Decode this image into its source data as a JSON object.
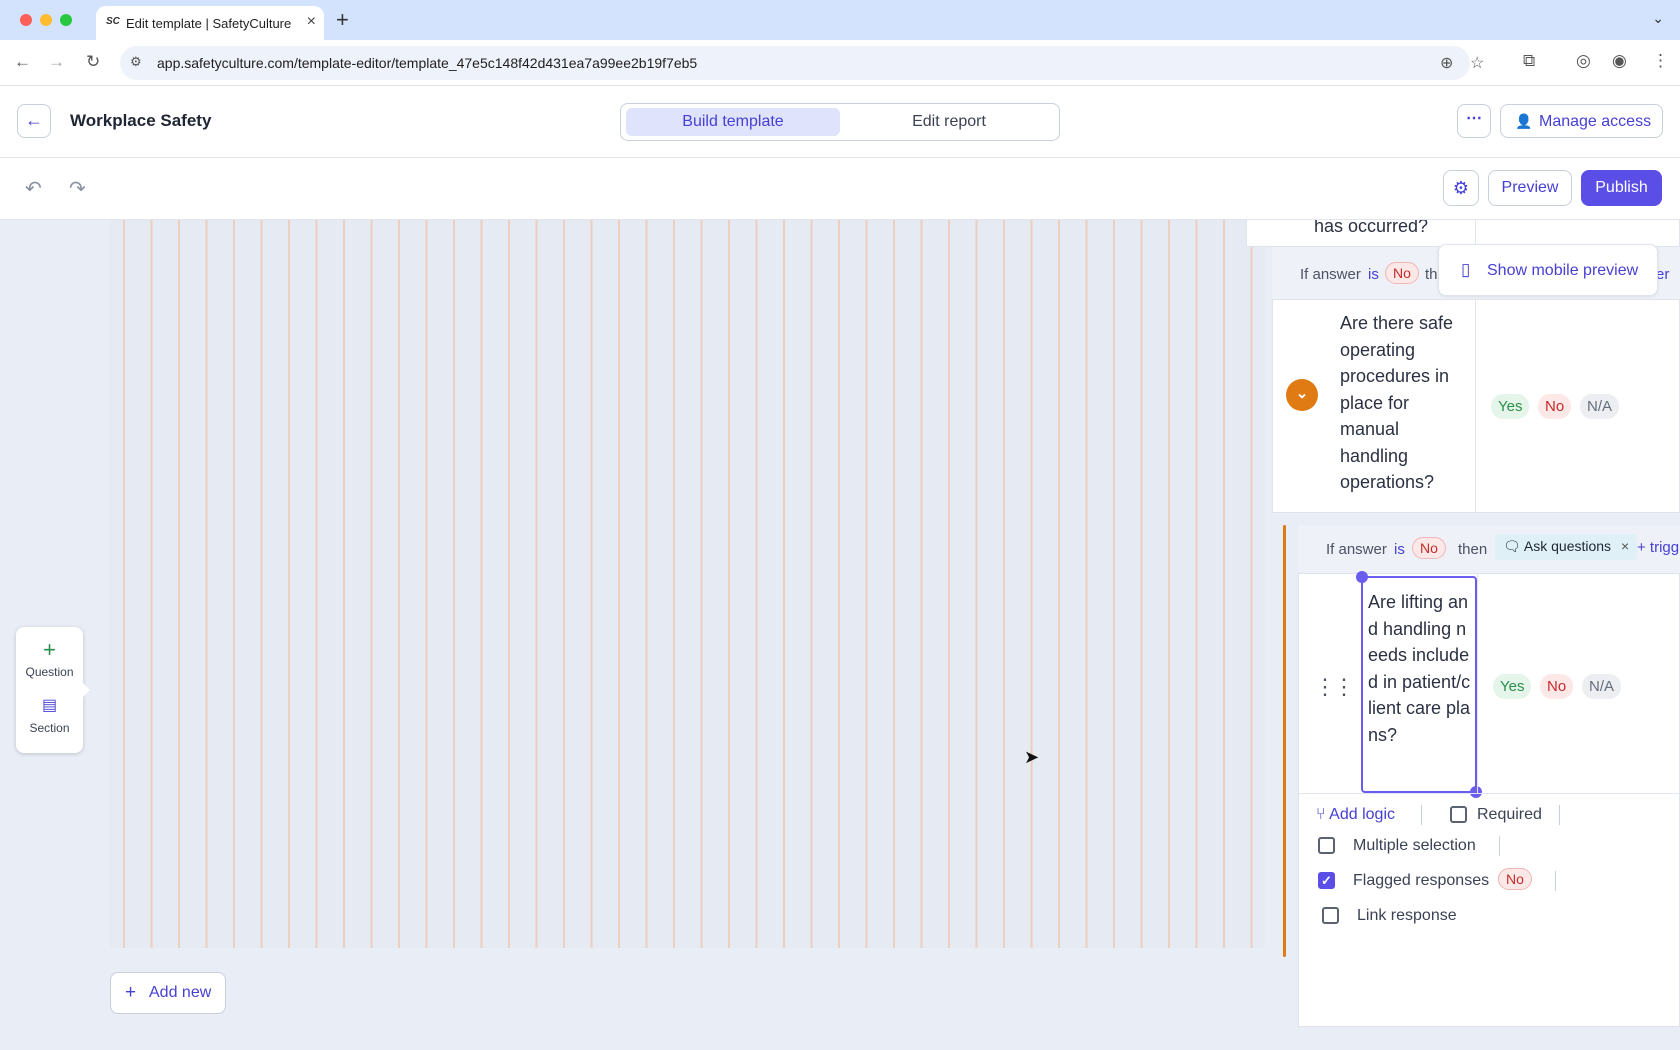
{
  "browser": {
    "tab_title": "Edit template | SafetyCulture",
    "tab_favicon": "SC",
    "url": "app.safetyculture.com/template-editor/template_47e5c148f42d431ea7a99ee2b19f7eb5",
    "icons": [
      "back-arrow-icon",
      "forward-arrow-icon",
      "reload-icon",
      "site-info-icon",
      "zoom-icon",
      "star-icon",
      "extensions-icon",
      "profile-icon",
      "menu-icon"
    ]
  },
  "header": {
    "title": "Workplace Safety",
    "tabs": [
      {
        "label": "Build template",
        "active": true
      },
      {
        "label": "Edit report",
        "active": false
      }
    ],
    "more_label": "⋯",
    "manage_access": "Manage access"
  },
  "toolbar": {
    "preview": "Preview",
    "publish": "Publish",
    "accent_color": "#5a4ee6"
  },
  "add_menu": {
    "question": "Question",
    "section": "Section"
  },
  "add_new": "Add new",
  "mobile_preview": "Show mobile preview",
  "previous_question": {
    "text": "has occurred?"
  },
  "logic_row_1": {
    "if_answer": "If answer",
    "is": "is",
    "value": "No",
    "then": "th",
    "trailing": "er"
  },
  "question_1": {
    "text": "Are there safe operating procedures in place for manual handling operations?",
    "responses": [
      "Yes",
      "No",
      "N/A"
    ]
  },
  "logic_row_2": {
    "if_answer": "If answer",
    "is": "is",
    "value": "No",
    "then": "then",
    "action": "Ask questions",
    "trigger": "+ trigg"
  },
  "question_2": {
    "text": "Are lifting and handling needs included in patient/client care plans?",
    "responses": [
      "Yes",
      "No",
      "N/A"
    ],
    "options": {
      "add_logic": "Add logic",
      "required": {
        "label": "Required",
        "checked": false
      },
      "multiple_selection": {
        "label": "Multiple selection",
        "checked": false
      },
      "flagged_responses": {
        "label": "Flagged responses",
        "checked": true,
        "value": "No"
      },
      "link_response": {
        "label": "Link response",
        "checked": false
      }
    }
  },
  "colors": {
    "brand": "#4740d4",
    "branch_orange": "#e07a12",
    "yes_green": "#2a8f4a",
    "no_red": "#c92a2a"
  }
}
